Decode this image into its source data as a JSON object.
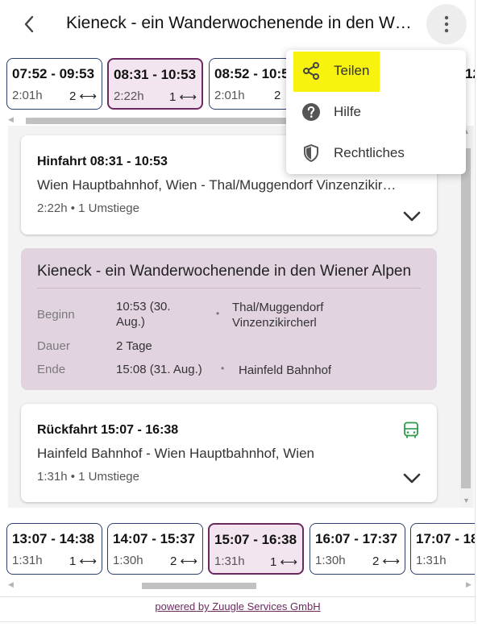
{
  "header": {
    "title": "Kieneck - ein Wanderwochenende in den Wiener Alpen",
    "back_icon": "chevron-left-icon",
    "more_icon": "more-vert-icon"
  },
  "outbound_connections": [
    {
      "time": "07:52 - 09:53",
      "duration": "2:01h",
      "changes": "2 ⟷",
      "selected": false
    },
    {
      "time": "08:31 - 10:53",
      "duration": "2:22h",
      "changes": "1 ⟷",
      "selected": true
    },
    {
      "time": "08:52 - 10:5",
      "duration": "2:01h",
      "changes": "2",
      "selected": false
    },
    {
      "time": "12",
      "duration": "",
      "changes": "",
      "selected": false
    }
  ],
  "outbound": {
    "title": "Hinfahrt 08:31 - 10:53",
    "route": "Wien Hauptbahnhof, Wien - Thal/Muggendorf Vinzenzikircherl",
    "meta": "2:22h • 1 Umstiege"
  },
  "tour": {
    "title": "Kieneck - ein Wanderwochenende in den Wiener Alpen",
    "begin_label": "Beginn",
    "begin_value_line1": "10:53 (30.",
    "begin_value_line2": "Aug.)",
    "begin_place_line1": "Thal/Muggendorf",
    "begin_place_line2": "Vinzenzikircherl",
    "duration_label": "Dauer",
    "duration_value": "2 Tage",
    "end_label": "Ende",
    "end_value": "15:08 (31. Aug.)",
    "end_place": "Hainfeld Bahnhof",
    "separator": "•"
  },
  "return": {
    "title": "Rückfahrt 15:07 - 16:38",
    "route": "Hainfeld Bahnhof - Wien Hauptbahnhof, Wien",
    "meta": "1:31h • 1 Umstiege",
    "transport_icon": "bus-icon",
    "accent_color": "#2e9a4a"
  },
  "return_connections": [
    {
      "time": "13:07 - 14:38",
      "duration": "1:31h",
      "changes": "1 ⟷",
      "selected": false
    },
    {
      "time": "14:07 - 15:37",
      "duration": "1:30h",
      "changes": "2 ⟷",
      "selected": false
    },
    {
      "time": "15:07 - 16:38",
      "duration": "1:31h",
      "changes": "1 ⟷",
      "selected": true
    },
    {
      "time": "16:07 - 17:37",
      "duration": "1:30h",
      "changes": "2 ⟷",
      "selected": false
    },
    {
      "time": "17:07 - 18",
      "duration": "1:31h",
      "changes": "",
      "selected": false
    }
  ],
  "menu": {
    "items": [
      {
        "label": "Teilen",
        "icon": "share-icon",
        "highlighted": true
      },
      {
        "label": "Hilfe",
        "icon": "help-icon",
        "highlighted": false
      },
      {
        "label": "Rechtliches",
        "icon": "shield-icon",
        "highlighted": false
      }
    ]
  },
  "footer": {
    "link_text": "powered by Zuugle Services GmbH"
  },
  "colors": {
    "accent": "#6b2a5f",
    "selected_bg": "#f3e5ef",
    "tour_bg": "#e2d3e1",
    "highlight": "#f7f30f",
    "card_border": "#2c3e6b"
  }
}
